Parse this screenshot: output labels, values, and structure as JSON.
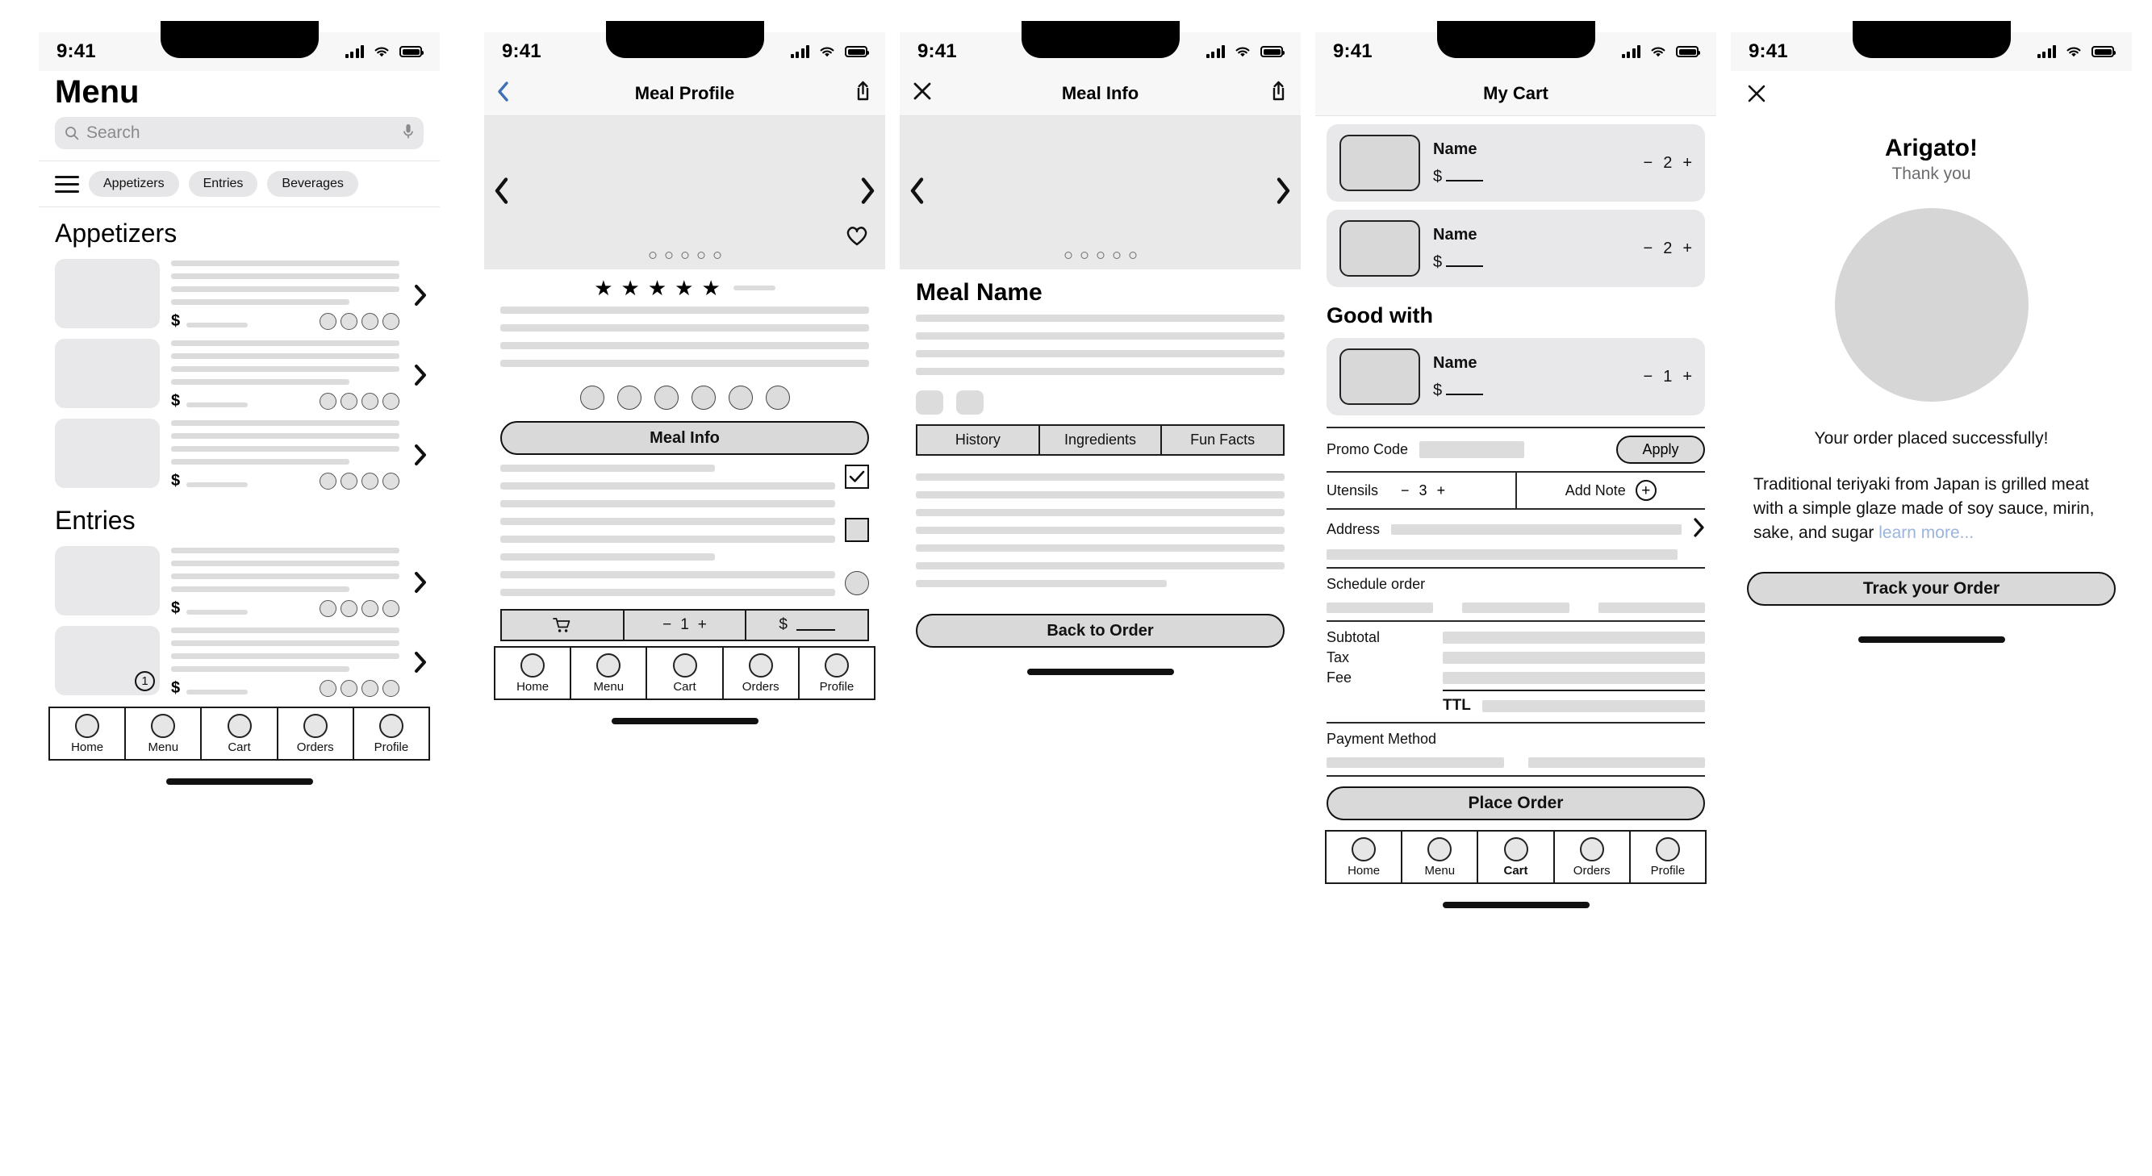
{
  "meta": {
    "status_time": "9:41"
  },
  "screen1": {
    "title": "Menu",
    "search_placeholder": "Search",
    "chips": [
      "Appetizers",
      "Entries",
      "Beverages"
    ],
    "sections": [
      {
        "heading": "Appetizers",
        "rows": 3
      },
      {
        "heading": "Entries",
        "rows": 2
      }
    ],
    "item_badge": "1",
    "currency": "$",
    "tabs": [
      "Home",
      "Menu",
      "Cart",
      "Orders",
      "Profile"
    ]
  },
  "screen2": {
    "nav_title": "Meal Profile",
    "back_icon": "chevron-left-icon",
    "share_icon": "share-icon",
    "carousel_dots": 5,
    "stars": 5,
    "meal_info_button": "Meal Info",
    "option_circles": 6,
    "cart_icon": "cart-icon",
    "qty_minus": "−",
    "qty_value": "1",
    "qty_plus": "+",
    "price_symbol": "$",
    "tabs": [
      "Home",
      "Menu",
      "Cart",
      "Orders",
      "Profile"
    ]
  },
  "screen3": {
    "nav_title": "Meal Info",
    "close_icon": "close-icon",
    "share_icon": "share-icon",
    "carousel_dots": 5,
    "meal_name": "Meal Name",
    "segments": [
      "History",
      "Ingredients",
      "Fun Facts"
    ],
    "back_button": "Back to Order"
  },
  "screen4": {
    "nav_title": "My Cart",
    "items": [
      {
        "name": "Name",
        "price_symbol": "$",
        "qty": "2"
      },
      {
        "name": "Name",
        "price_symbol": "$",
        "qty": "2"
      }
    ],
    "good_with_heading": "Good with",
    "good_with_items": [
      {
        "name": "Name",
        "price_symbol": "$",
        "qty": "1"
      }
    ],
    "promo_label": "Promo Code",
    "apply_label": "Apply",
    "utensils_label": "Utensils",
    "utensils_minus": "−",
    "utensils_qty": "3",
    "utensils_plus": "+",
    "add_note_label": "Add Note",
    "address_label": "Address",
    "schedule_label": "Schedule order",
    "totals": [
      "Subtotal",
      "Tax",
      "Fee"
    ],
    "total_label": "TTL",
    "payment_label": "Payment Method",
    "place_order": "Place Order",
    "tabs": [
      "Home",
      "Menu",
      "Cart",
      "Orders",
      "Profile"
    ]
  },
  "screen5": {
    "close_icon": "close-icon",
    "title": "Arigato!",
    "subtitle": "Thank you",
    "success_text": "Your order placed successfully!",
    "paragraph": "Traditional teriyaki from Japan is grilled meat with a simple glaze made of soy sauce, mirin, sake, and sugar ",
    "link_text": "learn more...",
    "track_button": "Track your Order"
  },
  "colors": {
    "placeholder_grey": "#dcdcdc",
    "panel_grey": "#e8e8ea",
    "hero_grey": "#e9e9ea",
    "link_blue": "#9bb4dd",
    "ink": "#111111"
  }
}
